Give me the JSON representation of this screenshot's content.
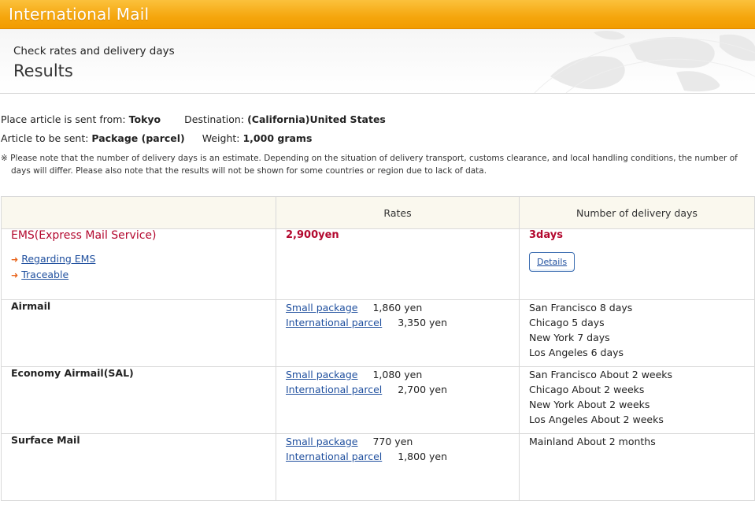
{
  "header": {
    "title": "International Mail",
    "subtitle": "Check rates and delivery days",
    "results": "Results"
  },
  "info": {
    "from_label": "Place article is sent from:",
    "from_value": "Tokyo",
    "dest_label": "Destination:",
    "dest_value": "(California)United States",
    "article_label": "Article to be sent:",
    "article_value": "Package (parcel)",
    "weight_label": "Weight:",
    "weight_value": "1,000 grams",
    "note": "※ Please note that the number of delivery days is an estimate. Depending on the situation of delivery transport, customs clearance, and local handling conditions, the number of days will differ. Please also note that the results will not be shown for some countries or region due to lack of data."
  },
  "table": {
    "headers": [
      "",
      "Rates",
      "Number of delivery days"
    ],
    "ems": {
      "name": "EMS(Express Mail Service)",
      "link1": "Regarding EMS",
      "link2": "Traceable",
      "rate": "2,900yen",
      "days": "3days",
      "details": "Details"
    },
    "rows": [
      {
        "method": "Airmail",
        "rates": [
          {
            "label": "Small package",
            "amount": "1,860 yen"
          },
          {
            "label": "International parcel",
            "amount": "3,350 yen"
          }
        ],
        "days": [
          "San Francisco 8 days",
          "Chicago 5 days",
          "New York 7 days",
          "Los Angeles 6 days"
        ]
      },
      {
        "method": "Economy Airmail(SAL)",
        "rates": [
          {
            "label": "Small package",
            "amount": "1,080 yen"
          },
          {
            "label": "International parcel",
            "amount": "2,700 yen"
          }
        ],
        "days": [
          "San Francisco About 2 weeks",
          "Chicago About 2 weeks",
          "New York About 2 weeks",
          "Los Angeles About 2 weeks"
        ]
      },
      {
        "method": "Surface Mail",
        "rates": [
          {
            "label": "Small package",
            "amount": "770 yen"
          },
          {
            "label": "International parcel",
            "amount": "1,800 yen"
          }
        ],
        "days": [
          "Mainland About 2 months"
        ]
      }
    ]
  }
}
